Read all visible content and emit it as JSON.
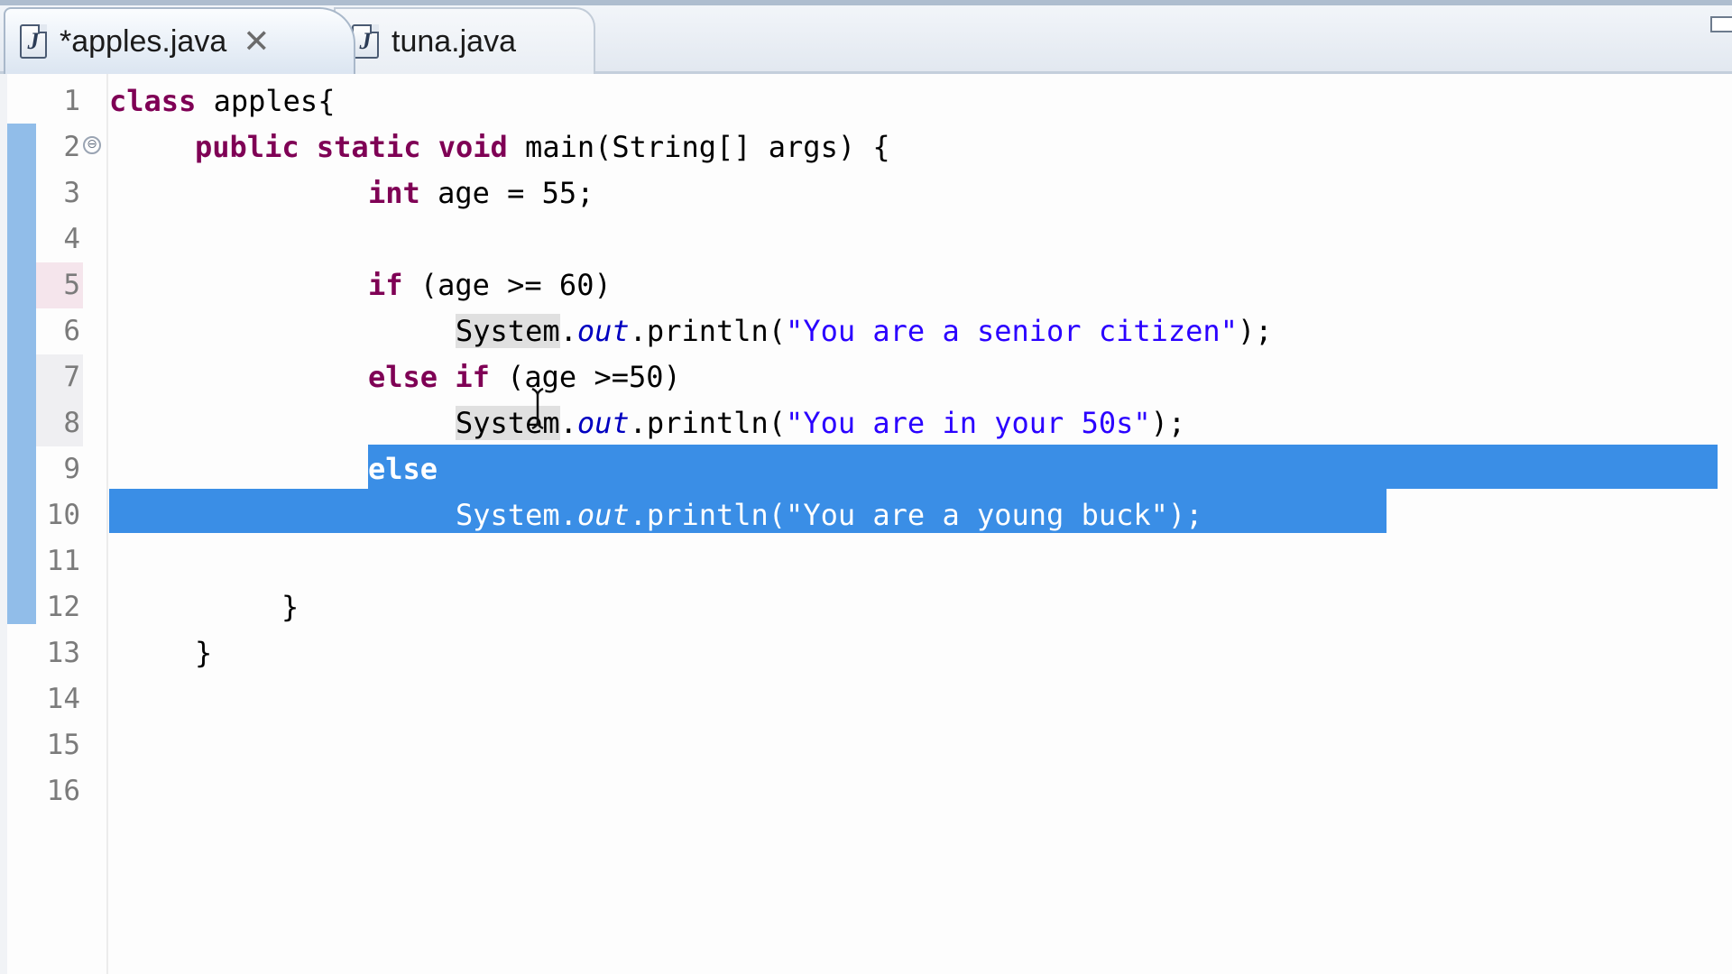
{
  "editor": {
    "tabs": [
      {
        "label": "*apples.java",
        "close_icon": "✕",
        "active": true
      },
      {
        "label": "tuna.java",
        "active": false
      }
    ],
    "line_numbers": [
      "1",
      "2",
      "3",
      "4",
      "5",
      "6",
      "7",
      "8",
      "9",
      "10",
      "11",
      "12",
      "13",
      "14",
      "15",
      "16"
    ],
    "fold_symbol": "⊖",
    "code": {
      "l1": {
        "kw": "class",
        "rest": " apples{"
      },
      "l2": {
        "kw": "public static void",
        "rest": " main(String[] args) {"
      },
      "l3": {
        "kw": "int",
        "rest": " age = 55;"
      },
      "l5": {
        "kw": "if",
        "rest": " (age >= 60)"
      },
      "l6": {
        "cls": "System",
        "dot": ".",
        "fld": "out",
        "call": ".println(",
        "str": "\"You are a senior citizen\"",
        "end": ");"
      },
      "l7": {
        "kw": "else if",
        "rest": " (age >=50)"
      },
      "l8": {
        "cls": "System",
        "dot": ".",
        "fld": "out",
        "call": ".println(",
        "str": "\"You are in your 50s\"",
        "end": ");"
      },
      "l9": {
        "kw": "else"
      },
      "l10": {
        "cls": "System",
        "dot": ".",
        "fld": "out",
        "call": ".println(",
        "str": "\"You are a young buck\"",
        "end": ");"
      },
      "l12": {
        "rest": "}"
      },
      "l13": {
        "rest": "}"
      }
    },
    "colors": {
      "keyword": "#7f0055",
      "string": "#2a00ff",
      "field": "#0000c0",
      "selection": "#3a8ee6",
      "change_bar": "#91bde9"
    }
  }
}
